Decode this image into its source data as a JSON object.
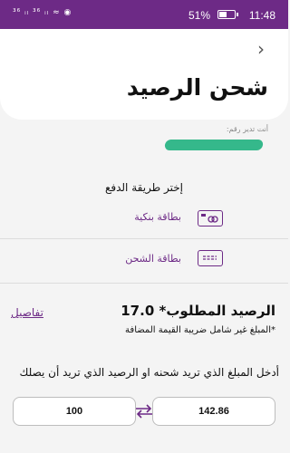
{
  "status_bar": {
    "left_indicators": "³⁶ ᵢₗ ³⁶ ᵢₗ ≈ ◉",
    "battery_percent": "51%",
    "battery_level": 0.51,
    "time": "11:48"
  },
  "header": {
    "back_icon": "chevron-right-icon",
    "title": "شحن الرصيد"
  },
  "account": {
    "manager_label": "أنت تدير رقم:",
    "number_masked": true
  },
  "payment": {
    "heading": "إختر طريقة الدفع",
    "methods": [
      {
        "label": "بطاقة بنكية",
        "icon": "credit-card-icon"
      },
      {
        "label": "بطاقة الشحن",
        "icon": "recharge-card-icon"
      }
    ]
  },
  "balance": {
    "required_label": "الرصيد المطلوب*",
    "required_value": "17.0",
    "details_link": "تفاصيل",
    "vat_note": "*المبلغ غير شامل ضريبة القيمة المضافة"
  },
  "amount": {
    "prompt": "أدخل المبلغ الذي تريد شحنه او الرصيد الذي تريد أن يصلك",
    "left_value": "100",
    "right_value": "142.86",
    "swap_icon": "swap-arrows-icon"
  },
  "colors": {
    "brand": "#6d2a86",
    "masked_number": "#35b88b"
  }
}
